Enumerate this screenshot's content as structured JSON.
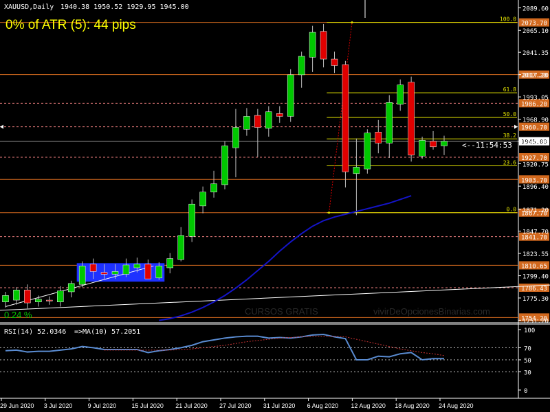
{
  "chart_data": {
    "type": "candlestick",
    "symbol_header": "XAUUSD,Daily",
    "ohlc_header": "1940.38 1950.52 1929.95 1945.00",
    "atr_text": "0% of ATR (5): 44 pips",
    "countdown": "<--11:54:53",
    "watermark_left": "CURSOS GRATIS",
    "watermark_right": "vivirDeOpcionesBinarias.com",
    "corner_value": "0.24 %",
    "colors": {
      "background": "#000000",
      "bull": "#00c800",
      "bear": "#e00000",
      "wick": "#c0c0c0",
      "ma": "#1414c8",
      "hline_solid": "#d2691e",
      "hline_dashed": "#f08080",
      "fib": "#e6e600",
      "rsi": "#5a8cd2",
      "rsi_ma": "#c83232",
      "axis": "#ffffff",
      "consolidation_box": "#1e32ff"
    },
    "price_axis": {
      "min": 1750.0,
      "max": 2095.0,
      "tick_labels": [
        "2089.60",
        "2065.10",
        "2041.35",
        "2017.20",
        "1993.05",
        "1968.90",
        "1945.00",
        "1920.75",
        "1896.40",
        "1871.20",
        "1847.70",
        "1823.55",
        "1799.40",
        "1775.30",
        "1751.20"
      ],
      "tick_values": [
        2089.6,
        2065.1,
        2041.35,
        2017.2,
        1993.05,
        1968.9,
        1945.0,
        1920.75,
        1896.4,
        1871.2,
        1847.7,
        1823.55,
        1799.4,
        1775.3,
        1751.2
      ]
    },
    "horizontal_levels": [
      {
        "value": 2073.7,
        "label": "2073.70",
        "style": "solid"
      },
      {
        "value": 2017.2,
        "label": "2017.20",
        "style": "solid"
      },
      {
        "value": 1986.2,
        "label": "1986.20",
        "style": "dashed"
      },
      {
        "value": 1960.7,
        "label": "1960.70",
        "style": "dashed"
      },
      {
        "value": 1945.0,
        "label": "1945.00",
        "style": "current"
      },
      {
        "value": 1927.7,
        "label": "1927.70",
        "style": "dashed"
      },
      {
        "value": 1903.7,
        "label": "1903.70",
        "style": "solid"
      },
      {
        "value": 1867.7,
        "label": "1867.70",
        "style": "solid"
      },
      {
        "value": 1841.7,
        "label": "1841.70",
        "style": "dashed"
      },
      {
        "value": 1810.65,
        "label": "1810.65",
        "style": "solid"
      },
      {
        "value": 1786.43,
        "label": "1786.43",
        "style": "dashed"
      },
      {
        "value": 1754.2,
        "label": "1754.20",
        "style": "solid"
      }
    ],
    "fib_levels": [
      {
        "label": "100.0",
        "value": 2073.7
      },
      {
        "label": "61.8",
        "value": 1997.5
      },
      {
        "label": "50.0",
        "value": 1970.8
      },
      {
        "label": "38.2",
        "value": 1947.6
      },
      {
        "label": "23.6",
        "value": 1918.4
      },
      {
        "label": "0.0",
        "value": 1867.7
      }
    ],
    "candles": [
      {
        "o": 1771,
        "h": 1782,
        "l": 1765,
        "c": 1778
      },
      {
        "o": 1773,
        "h": 1787,
        "l": 1768,
        "c": 1784
      },
      {
        "o": 1784,
        "h": 1790,
        "l": 1764,
        "c": 1770
      },
      {
        "o": 1771,
        "h": 1778,
        "l": 1766,
        "c": 1774
      },
      {
        "o": 1773,
        "h": 1777,
        "l": 1768,
        "c": 1772
      },
      {
        "o": 1771,
        "h": 1788,
        "l": 1766,
        "c": 1783
      },
      {
        "o": 1782,
        "h": 1794,
        "l": 1776,
        "c": 1791
      },
      {
        "o": 1790,
        "h": 1815,
        "l": 1787,
        "c": 1810
      },
      {
        "o": 1812,
        "h": 1818,
        "l": 1796,
        "c": 1804
      },
      {
        "o": 1803,
        "h": 1812,
        "l": 1796,
        "c": 1801
      },
      {
        "o": 1801,
        "h": 1812,
        "l": 1796,
        "c": 1804
      },
      {
        "o": 1801,
        "h": 1818,
        "l": 1798,
        "c": 1811
      },
      {
        "o": 1808,
        "h": 1819,
        "l": 1803,
        "c": 1812
      },
      {
        "o": 1812,
        "h": 1817,
        "l": 1797,
        "c": 1796
      },
      {
        "o": 1797,
        "h": 1814,
        "l": 1795,
        "c": 1810
      },
      {
        "o": 1808,
        "h": 1824,
        "l": 1802,
        "c": 1818
      },
      {
        "o": 1817,
        "h": 1852,
        "l": 1815,
        "c": 1843
      },
      {
        "o": 1842,
        "h": 1882,
        "l": 1836,
        "c": 1877
      },
      {
        "o": 1875,
        "h": 1896,
        "l": 1867,
        "c": 1890
      },
      {
        "o": 1890,
        "h": 1913,
        "l": 1884,
        "c": 1899
      },
      {
        "o": 1898,
        "h": 1945,
        "l": 1893,
        "c": 1940
      },
      {
        "o": 1938,
        "h": 1980,
        "l": 1906,
        "c": 1960
      },
      {
        "o": 1958,
        "h": 1981,
        "l": 1951,
        "c": 1972
      },
      {
        "o": 1973,
        "h": 1980,
        "l": 1928,
        "c": 1960
      },
      {
        "o": 1959,
        "h": 1983,
        "l": 1950,
        "c": 1977
      },
      {
        "o": 1975,
        "h": 1983,
        "l": 1965,
        "c": 1972
      },
      {
        "o": 1972,
        "h": 2023,
        "l": 1966,
        "c": 2017
      },
      {
        "o": 2017,
        "h": 2042,
        "l": 2003,
        "c": 2037
      },
      {
        "o": 2036,
        "h": 2070,
        "l": 2020,
        "c": 2063
      },
      {
        "o": 2064,
        "h": 2072,
        "l": 2025,
        "c": 2034
      },
      {
        "o": 2034,
        "h": 2042,
        "l": 2019,
        "c": 2027
      },
      {
        "o": 2028,
        "h": 2032,
        "l": 1895,
        "c": 1912
      },
      {
        "o": 1910,
        "h": 1948,
        "l": 1865,
        "c": 1917
      },
      {
        "o": 1915,
        "h": 1958,
        "l": 1910,
        "c": 1954
      },
      {
        "o": 1955,
        "h": 1968,
        "l": 1932,
        "c": 1943
      },
      {
        "o": 1943,
        "h": 1995,
        "l": 1927,
        "c": 1987
      },
      {
        "o": 1985,
        "h": 2012,
        "l": 1978,
        "c": 2006
      },
      {
        "o": 2009,
        "h": 2015,
        "l": 1923,
        "c": 1930
      },
      {
        "o": 1929,
        "h": 1950,
        "l": 1926,
        "c": 1946
      },
      {
        "o": 1945,
        "h": 1956,
        "l": 1936,
        "c": 1939
      },
      {
        "o": 1940,
        "h": 1951,
        "l": 1930,
        "c": 1945
      }
    ],
    "ma_series": [
      1751,
      1753,
      1756,
      1760,
      1765,
      1771,
      1778,
      1786,
      1795,
      1805,
      1815,
      1826,
      1836,
      1845,
      1853,
      1859,
      1863,
      1866,
      1869,
      1872,
      1875,
      1878,
      1882,
      1886
    ],
    "ma_start_index": 17,
    "trendline_white": {
      "start": {
        "i": -0.5,
        "v": 1762
      },
      "end": {
        "i": 51,
        "v": 1790
      }
    },
    "trendline_white_short": {
      "start": {
        "i": 0,
        "v": 1766
      },
      "end": {
        "i": 13.5,
        "v": 1810
      }
    },
    "fib_anchor": {
      "start": {
        "i": 29.5,
        "v": 1867.7
      },
      "end": {
        "i": 31.6,
        "v": 2073.7
      }
    },
    "consolidation_box": {
      "i_start": 6.5,
      "i_end": 14.5,
      "v_low": 1793,
      "v_high": 1813
    },
    "rsi": {
      "label": "RSI(14) 52.0346",
      "ma_label": "=>MA(10) 57.2051",
      "min": 0,
      "max": 100,
      "tick_labels": [
        "100",
        "70",
        "50",
        "30",
        "0"
      ],
      "tick_values": [
        100,
        70,
        50,
        30,
        0
      ],
      "dotted_levels": [
        70,
        50,
        30
      ],
      "values": [
        65,
        66,
        63,
        64,
        64,
        66,
        68,
        72,
        70,
        67,
        67,
        67,
        67,
        62,
        65,
        67,
        70,
        74,
        80,
        83,
        86,
        88,
        89,
        89,
        86,
        87,
        86,
        88,
        91,
        92,
        88,
        85,
        50,
        50,
        56,
        55,
        60,
        62,
        50,
        52,
        52
      ],
      "ma_values": [
        null,
        null,
        null,
        null,
        null,
        null,
        null,
        null,
        null,
        66,
        66,
        66,
        66,
        66,
        66,
        66,
        67,
        68,
        70,
        72,
        74,
        77,
        80,
        82,
        84,
        86,
        87,
        88,
        89,
        89,
        89,
        88,
        84,
        80,
        76,
        72,
        68,
        65,
        62,
        60,
        57
      ]
    },
    "date_labels": [
      {
        "i": 0,
        "label": "29 Jun 2020"
      },
      {
        "i": 4,
        "label": "3 Jul 2020"
      },
      {
        "i": 8,
        "label": "9 Jul 2020"
      },
      {
        "i": 12,
        "label": "15 Jul 2020"
      },
      {
        "i": 16,
        "label": "21 Jul 2020"
      },
      {
        "i": 20,
        "label": "27 Jul 2020"
      },
      {
        "i": 24,
        "label": "31 Jul 2020"
      },
      {
        "i": 28,
        "label": "6 Aug 2020"
      },
      {
        "i": 32,
        "label": "12 Aug 2020"
      },
      {
        "i": 36,
        "label": "18 Aug 2020"
      },
      {
        "i": 40,
        "label": "24 Aug 2020"
      }
    ]
  }
}
